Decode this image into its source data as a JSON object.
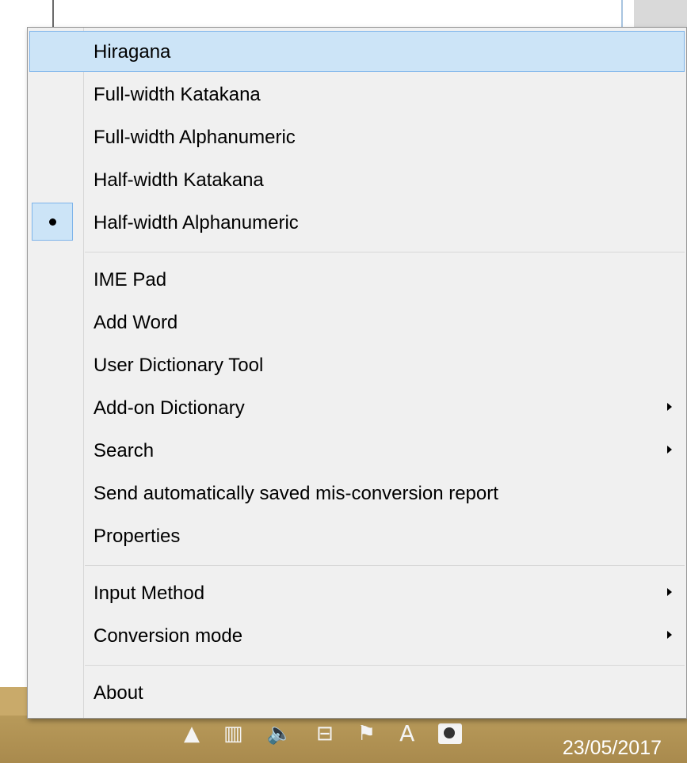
{
  "taskbar": {
    "tray_letter": "A",
    "date": "23/05/2017",
    "tray_icons": [
      "show-hidden-icons-arrow-icon",
      "network-icon",
      "volume-icon",
      "connection-icon",
      "action-center-error-icon",
      "ime-mode-indicator",
      "app-tray-icon"
    ]
  },
  "menu": {
    "items": [
      {
        "label": "Hiragana"
      },
      {
        "label": "Full-width Katakana"
      },
      {
        "label": "Full-width Alphanumeric"
      },
      {
        "label": "Half-width Katakana"
      },
      {
        "label": "Half-width Alphanumeric",
        "selected": true
      },
      {
        "label": "IME Pad"
      },
      {
        "label": "Add Word"
      },
      {
        "label": "User Dictionary Tool"
      },
      {
        "label": "Add-on Dictionary",
        "submenu": true
      },
      {
        "label": "Search",
        "submenu": true
      },
      {
        "label": "Send automatically saved mis-conversion report"
      },
      {
        "label": "Properties"
      },
      {
        "label": "Input Method",
        "submenu": true
      },
      {
        "label": "Conversion mode",
        "submenu": true
      },
      {
        "label": "About"
      }
    ]
  },
  "colors": {
    "menu_background": "#f0f0f0",
    "highlight": "#cce4f7",
    "highlight_border": "#7eb4ea",
    "taskbar": "#b89a5a"
  }
}
